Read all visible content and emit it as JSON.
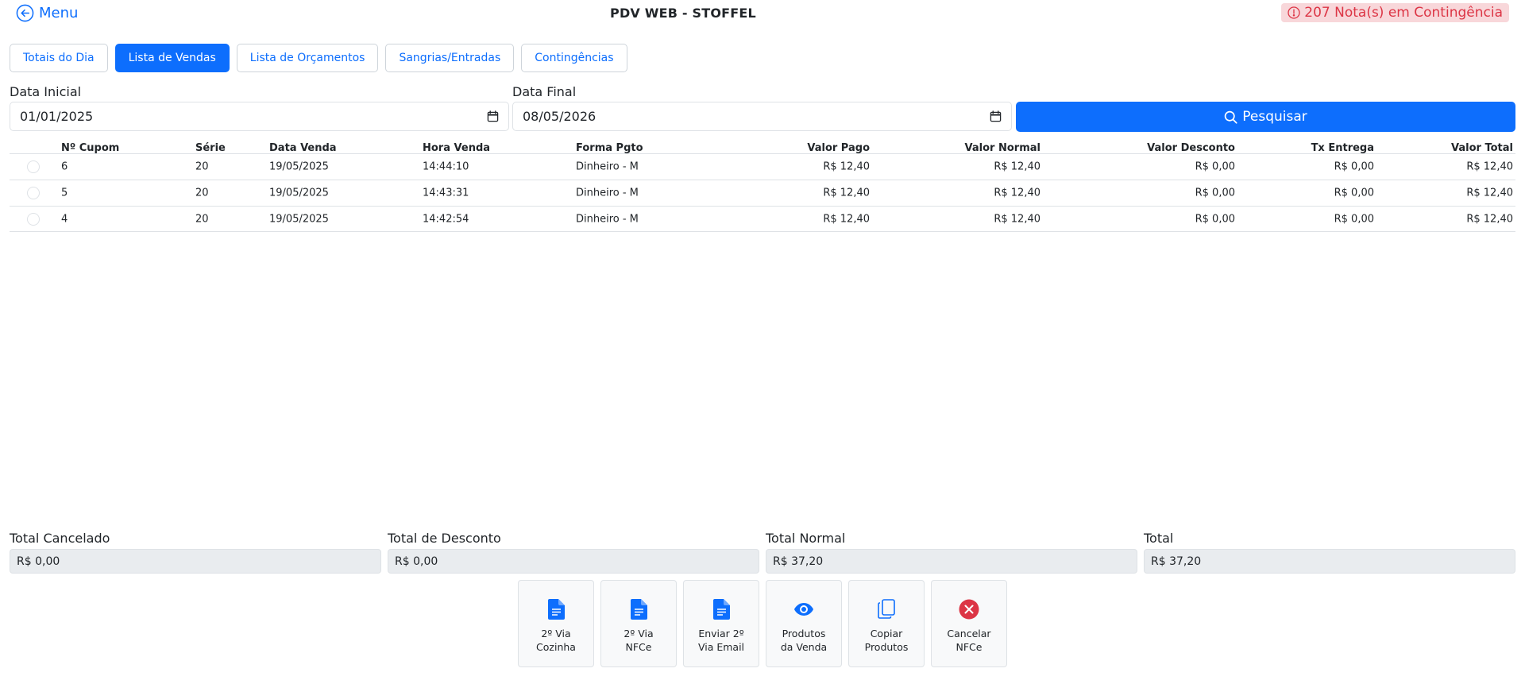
{
  "header": {
    "menu_label": "Menu",
    "title": "PDV WEB - STOFFEL",
    "alert": "207 Nota(s) em Contingência"
  },
  "tabs": [
    {
      "label": "Totais do Dia",
      "active": false
    },
    {
      "label": "Lista de Vendas",
      "active": true
    },
    {
      "label": "Lista de Orçamentos",
      "active": false
    },
    {
      "label": "Sangrias/Entradas",
      "active": false
    },
    {
      "label": "Contingências",
      "active": false
    }
  ],
  "filters": {
    "start_label": "Data Inicial",
    "start_value": "01/01/2025",
    "end_label": "Data Final",
    "end_value": "08/05/2026",
    "search_label": "Pesquisar"
  },
  "table": {
    "columns": [
      "Nº Cupom",
      "Série",
      "Data Venda",
      "Hora Venda",
      "Forma Pgto",
      "Valor Pago",
      "Valor Normal",
      "Valor Desconto",
      "Tx Entrega",
      "Valor Total"
    ],
    "rows": [
      [
        "6",
        "20",
        "19/05/2025",
        "14:44:10",
        "Dinheiro - M",
        "R$ 12,40",
        "R$ 12,40",
        "R$ 0,00",
        "R$ 0,00",
        "R$ 12,40"
      ],
      [
        "5",
        "20",
        "19/05/2025",
        "14:43:31",
        "Dinheiro - M",
        "R$ 12,40",
        "R$ 12,40",
        "R$ 0,00",
        "R$ 0,00",
        "R$ 12,40"
      ],
      [
        "4",
        "20",
        "19/05/2025",
        "14:42:54",
        "Dinheiro - M",
        "R$ 12,40",
        "R$ 12,40",
        "R$ 0,00",
        "R$ 0,00",
        "R$ 12,40"
      ]
    ]
  },
  "totals": [
    {
      "label": "Total Cancelado",
      "value": "R$ 0,00"
    },
    {
      "label": "Total de Desconto",
      "value": "R$ 0,00"
    },
    {
      "label": "Total Normal",
      "value": "R$ 37,20"
    },
    {
      "label": "Total",
      "value": "R$ 37,20"
    }
  ],
  "actions": [
    {
      "label": "2º Via\nCozinha",
      "icon": "document-icon"
    },
    {
      "label": "2º Via\nNFCe",
      "icon": "document-icon"
    },
    {
      "label": "Enviar 2º\nVia Email",
      "icon": "document-icon"
    },
    {
      "label": "Produtos\nda Venda",
      "icon": "eye-icon"
    },
    {
      "label": "Copiar\nProdutos",
      "icon": "copy-icon"
    },
    {
      "label": "Cancelar\nNFCe",
      "icon": "cancel-icon"
    }
  ],
  "colors": {
    "primary": "#0d6efd",
    "danger": "#dc3545",
    "alert_bg": "#f8d7da",
    "readonly_bg": "#e9ecef"
  }
}
